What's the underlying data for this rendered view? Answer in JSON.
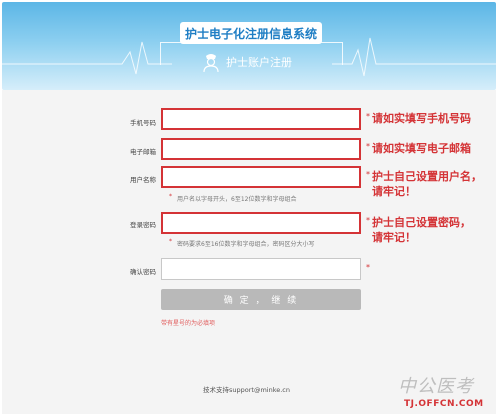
{
  "header": {
    "system_title": "护士电子化注册信息系统",
    "subtitle": "护士账户注册"
  },
  "form": {
    "phone_label": "手机号码",
    "email_label": "电子邮箱",
    "username_label": "用户名称",
    "username_hint": "用户名以字母开头，6至12位数字和字母组合",
    "password_label": "登录密码",
    "password_hint": "密码要求6至16位数字和字母组合，密码区分大小写",
    "confirm_label": "确认密码",
    "required_mark": "*",
    "submit_label": "确 定 ， 继 续",
    "required_note": "带有星号的为必填项"
  },
  "annotations": {
    "phone_note": "请如实填写手机号码",
    "email_note": "请如实填写电子邮箱",
    "username_note_line1": "护士自己设置用户名，",
    "username_note_line2": "请牢记！",
    "password_note_line1": "护士自己设置密码，",
    "password_note_line2": "请牢记！"
  },
  "footer": {
    "support": "技术支持support@minke.cn"
  },
  "watermark": {
    "brand": "中公医考",
    "url": "TJ.OFFCN.COM"
  },
  "colors": {
    "accent_red": "#d43336",
    "header_blue": "#5cb6e6",
    "button_gray": "#b9b9b9"
  }
}
